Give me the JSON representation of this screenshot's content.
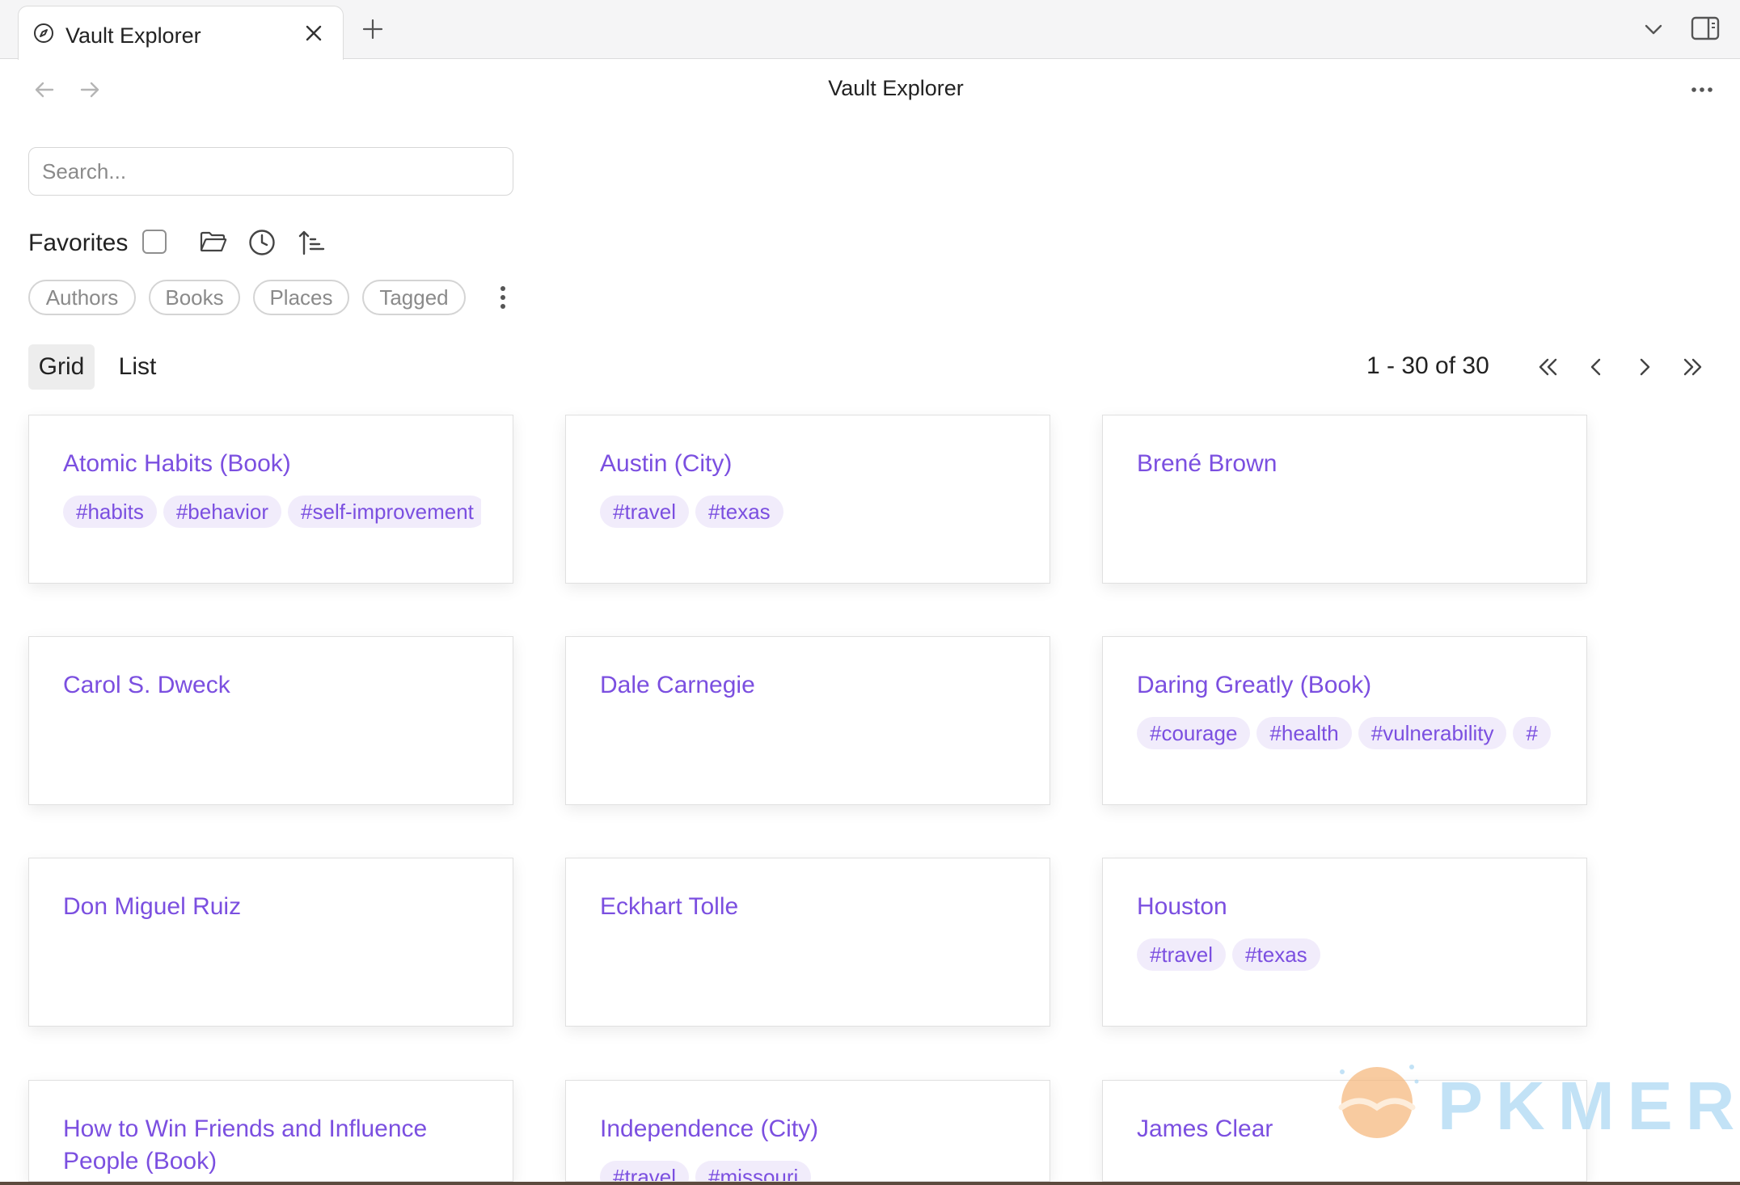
{
  "tabbar": {
    "tab_title": "Vault Explorer"
  },
  "header": {
    "title": "Vault Explorer"
  },
  "search": {
    "placeholder": "Search...",
    "value": ""
  },
  "favorites": {
    "label": "Favorites",
    "checked": false
  },
  "toolbar_icons": [
    "folder-open-icon",
    "clock-icon",
    "sort-ascending-icon"
  ],
  "filters": [
    "Authors",
    "Books",
    "Places",
    "Tagged"
  ],
  "view": {
    "grid_label": "Grid",
    "list_label": "List",
    "active": "Grid"
  },
  "pager": {
    "count_text": "1 - 30 of 30"
  },
  "cards": [
    {
      "title": "Atomic Habits (Book)",
      "tags": [
        "#habits",
        "#behavior",
        "#self-improvement"
      ]
    },
    {
      "title": "Austin (City)",
      "tags": [
        "#travel",
        "#texas"
      ]
    },
    {
      "title": "Brené Brown",
      "tags": []
    },
    {
      "title": "Carol S. Dweck",
      "tags": []
    },
    {
      "title": "Dale Carnegie",
      "tags": []
    },
    {
      "title": "Daring Greatly (Book)",
      "tags": [
        "#courage",
        "#health",
        "#vulnerability",
        "#"
      ]
    },
    {
      "title": "Don Miguel Ruiz",
      "tags": []
    },
    {
      "title": "Eckhart Tolle",
      "tags": []
    },
    {
      "title": "Houston",
      "tags": [
        "#travel",
        "#texas"
      ]
    },
    {
      "title": "How to Win Friends and Influence People (Book)",
      "tags": []
    },
    {
      "title": "Independence (City)",
      "tags": [
        "#travel",
        "#missouri"
      ]
    },
    {
      "title": "James Clear",
      "tags": []
    }
  ],
  "watermark": {
    "text": "PKMER"
  },
  "colors": {
    "accent": "#7b4fe0",
    "tag_bg": "#f1ecfb",
    "tabbar_bg": "#f5f5f6"
  }
}
